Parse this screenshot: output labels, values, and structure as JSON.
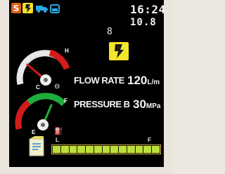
{
  "status_bar": {
    "mode_letter": "S",
    "icons": [
      "key-icon",
      "truck-icon",
      "tank-icon"
    ]
  },
  "clock": "16:24",
  "voltage": "10.8",
  "mode_indicator": "8",
  "gauges": {
    "temperature": {
      "high_label": "H",
      "low_label": "C",
      "symbol": "thermometer-icon"
    },
    "fuel": {
      "full_label": "F",
      "empty_label": "E",
      "symbol": "fuel-pump-icon"
    }
  },
  "readouts": [
    {
      "label": "FLOW RATE",
      "value": "120",
      "unit": "L/m"
    },
    {
      "label": "PRESSURE B",
      "value": "30",
      "unit": "MPa"
    }
  ],
  "level_bar": {
    "low_label": "L",
    "high_label": "F",
    "segments": 13
  },
  "colors": {
    "screen": "#000000",
    "key_yellow": "#f2e02a",
    "s_badge": "#e15d1c",
    "icon_blue": "#29a8e4",
    "bar_green": "#bde03c",
    "gauge_red": "#d21b1b",
    "gauge_green": "#1fae3b"
  }
}
